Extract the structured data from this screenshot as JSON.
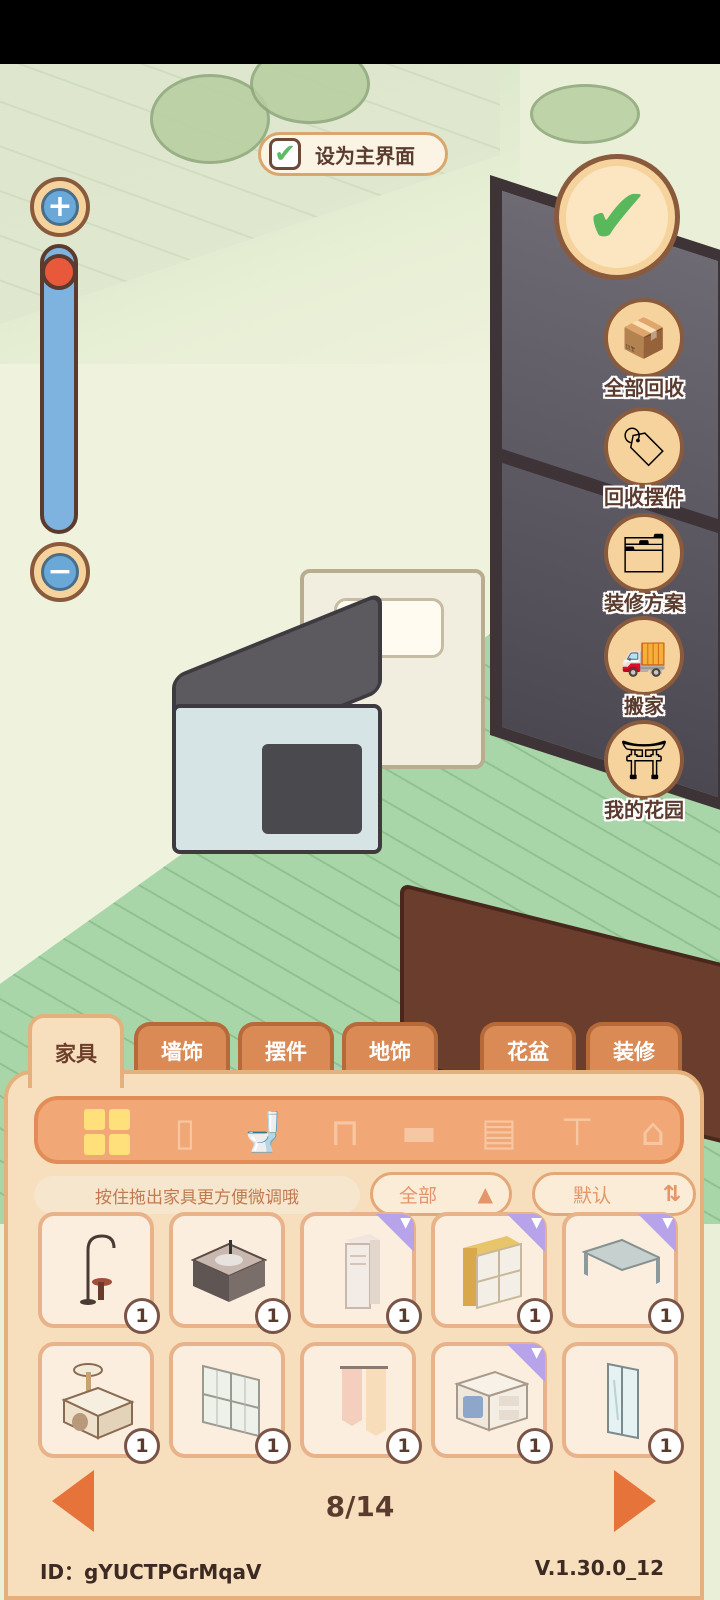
{
  "top_overlay": {
    "set_main_label": "设为主界面"
  },
  "side_buttons": [
    {
      "label": "全部回收",
      "icon": "box-down-icon"
    },
    {
      "label": "回收摆件",
      "icon": "box-tag-icon"
    },
    {
      "label": "装修方案",
      "icon": "folder-plus-icon"
    },
    {
      "label": "搬家",
      "icon": "moving-truck-icon"
    },
    {
      "label": "我的花园",
      "icon": "garden-arch-icon"
    }
  ],
  "tabs": [
    {
      "label": "家具",
      "active": true
    },
    {
      "label": "墙饰",
      "active": false
    },
    {
      "label": "摆件",
      "active": false
    },
    {
      "label": "地饰",
      "active": false
    },
    {
      "label": "花盆",
      "active": false
    },
    {
      "label": "装修",
      "active": false
    }
  ],
  "categories": [
    "all-grid-icon",
    "fridge-icon",
    "toilet-icon",
    "stool-icon",
    "bed-icon",
    "cabinet-icon",
    "table-icon",
    "lamp-icon"
  ],
  "hint": "按住拖出家具更方便微调哦",
  "filter": {
    "label": "全部"
  },
  "sort": {
    "label": "默认"
  },
  "items": [
    {
      "name": "floor-lamp-stool",
      "count": "1",
      "ribbon": false
    },
    {
      "name": "bathroom-sink-cabinet",
      "count": "1",
      "ribbon": false
    },
    {
      "name": "air-conditioner",
      "count": "1",
      "ribbon": true
    },
    {
      "name": "wardrobe",
      "count": "1",
      "ribbon": true
    },
    {
      "name": "glass-table",
      "count": "1",
      "ribbon": true
    },
    {
      "name": "cat-tree",
      "count": "1",
      "ribbon": false
    },
    {
      "name": "window-panel",
      "count": "1",
      "ribbon": false
    },
    {
      "name": "curtain",
      "count": "1",
      "ribbon": false
    },
    {
      "name": "nightstand-safe",
      "count": "1",
      "ribbon": true
    },
    {
      "name": "glass-shower",
      "count": "1",
      "ribbon": false
    }
  ],
  "pagination": {
    "page": "8/14"
  },
  "footer": {
    "id": "ID：gYUCTPGrMqaV",
    "version": "V.1.30.0_12"
  },
  "colors": {
    "accent": "#e6733a",
    "panel": "#f7dfbd",
    "check": "#59b85c"
  }
}
